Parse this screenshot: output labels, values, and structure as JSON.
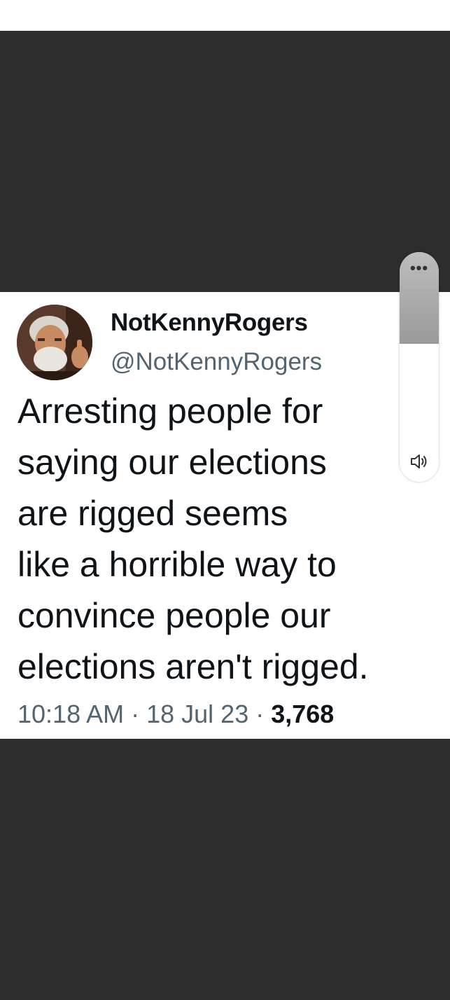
{
  "tweet": {
    "display_name": "NotKennyRogers",
    "handle": "@NotKennyRogers",
    "text_lines": [
      "Arresting people for",
      "saying our elections",
      "are rigged seems",
      "like a horrible way to",
      "convince people our",
      "elections aren't rigged."
    ],
    "time": "10:18 AM",
    "separator": " · ",
    "date": "18 Jul 23",
    "views": "3,768"
  },
  "volume_control": {
    "more_glyph": "•••",
    "level": 0.4,
    "icon": "speaker-icon"
  },
  "colors": {
    "background": "#2d2d2d",
    "card": "#ffffff",
    "primary_text": "#0f1419",
    "secondary_text": "#536471"
  }
}
